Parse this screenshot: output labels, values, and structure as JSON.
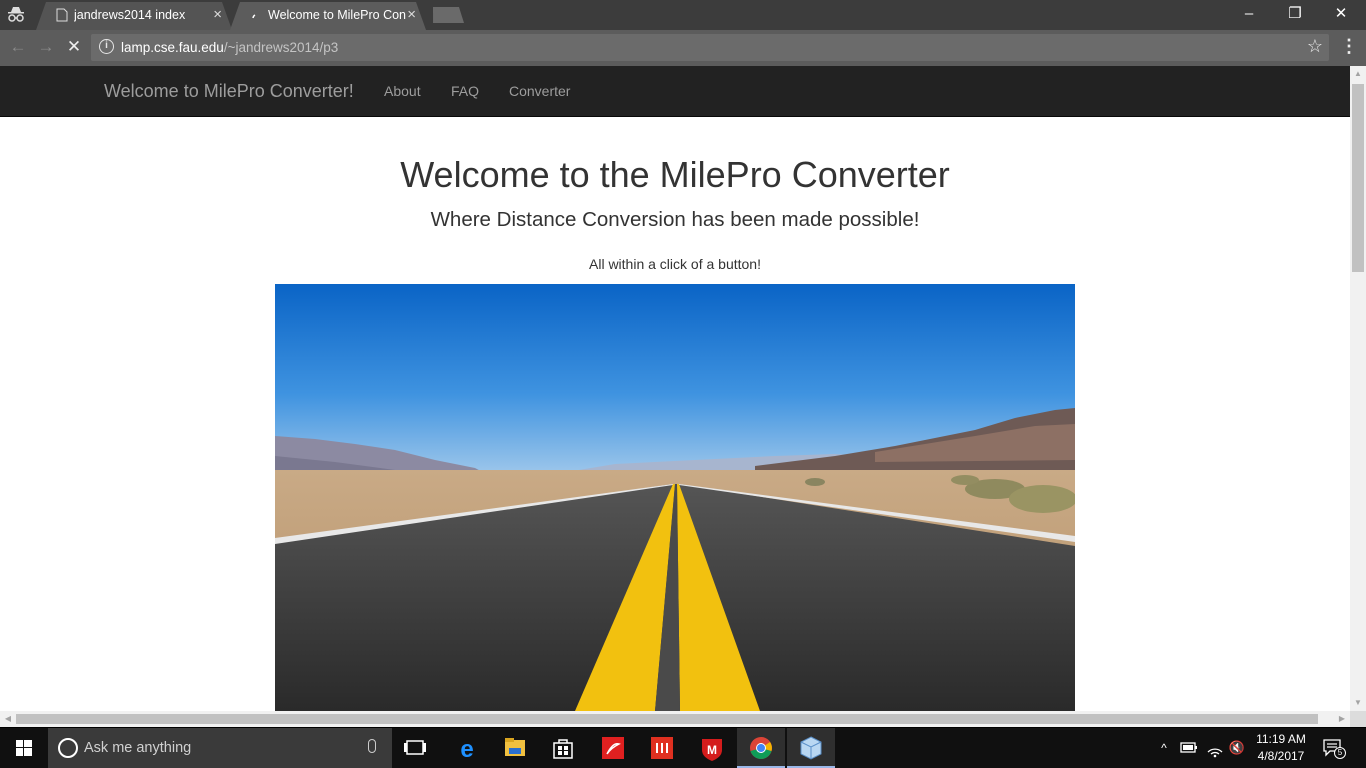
{
  "browser": {
    "tabs": [
      {
        "title": "jandrews2014 index",
        "close": "×"
      },
      {
        "title": "Welcome to MilePro Converter",
        "close": "×"
      }
    ],
    "url_host": "lamp.cse.fau.edu",
    "url_path": "/~jandrews2014/p3",
    "window_controls": {
      "minimize": "–",
      "restore": "❐",
      "close": "✕"
    }
  },
  "site": {
    "brand": "Welcome to MilePro Converter!",
    "nav": [
      "About",
      "FAQ",
      "Converter"
    ],
    "heading": "Welcome to the MilePro Converter",
    "subheading": "Where Distance Conversion has been made possible!",
    "tagline": "All within a click of a button!",
    "hero_image": "desert-highway-photo"
  },
  "taskbar": {
    "search_placeholder": "Ask me anything",
    "time": "11:19 AM",
    "date": "4/8/2017",
    "notification_count": "5"
  }
}
